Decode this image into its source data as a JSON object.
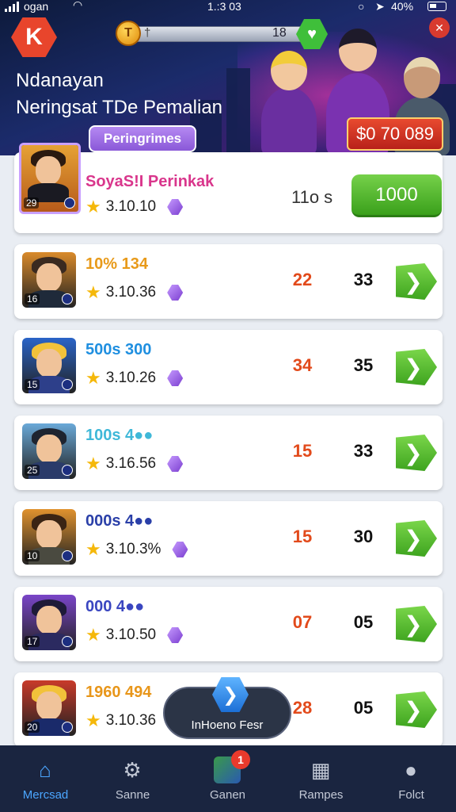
{
  "status_bar": {
    "carrier": "ogan",
    "time": "1.:3 03",
    "battery": "40%"
  },
  "header": {
    "progress_value": "18",
    "progress_coin": "T",
    "progress_pin": "†",
    "title": "Ndanayan",
    "subtitle": "Neringsat TDe Pemalian",
    "prize": "$0 70 089",
    "filter_tab": "Peringrimes"
  },
  "featured": {
    "name": "SoyaS!I Perinkak",
    "name_color": "#d9368c",
    "level": "29",
    "rating": "3.10.10",
    "time": "11o s",
    "claim_label": "1000"
  },
  "rows": [
    {
      "name": "10% 134",
      "name_color": "#e89a1a",
      "level": "16",
      "rating": "3.10.36",
      "col_a": "22",
      "col_b": "33",
      "avatar_bg": "#d98a2a",
      "hair": "#3a2a20",
      "shirt": "#1f2a3a"
    },
    {
      "name": "500s 300",
      "name_color": "#1f8fe0",
      "level": "15",
      "rating": "3.10.26",
      "col_a": "34",
      "col_b": "35",
      "avatar_bg": "#2a64c8",
      "hair": "#f2c23a",
      "shirt": "#2d3f8a"
    },
    {
      "name": "100s 4●●",
      "name_color": "#3fb8d8",
      "level": "25",
      "rating": "3.16.56",
      "col_a": "15",
      "col_b": "33",
      "avatar_bg": "#6aa9d8",
      "hair": "#1e2430",
      "shirt": "#2a3b6a"
    },
    {
      "name": "000s 4●●",
      "name_color": "#2a3fa8",
      "level": "10",
      "rating": "3.10.3%",
      "col_a": "15",
      "col_b": "30",
      "avatar_bg": "#e0922e",
      "hair": "#3a2414",
      "shirt": "#4a4a40"
    },
    {
      "name": "000 4●●",
      "name_color": "#3a46c0",
      "level": "17",
      "rating": "3.10.50",
      "col_a": "07",
      "col_b": "05",
      "avatar_bg": "#7a45c8",
      "hair": "#1e1a38",
      "shirt": "#2b2a60"
    },
    {
      "name": "1960 494",
      "name_color": "#e8961a",
      "level": "20",
      "rating": "3.10.36",
      "col_a": "28",
      "col_b": "05",
      "avatar_bg": "#c83a2a",
      "hair": "#f2c23a",
      "shirt": "#1a2a6a"
    }
  ],
  "toast": {
    "label": "InHoeno Fesr"
  },
  "nav": [
    {
      "label": "Mercsad",
      "icon": "home-icon",
      "active": true
    },
    {
      "label": "Sanne",
      "icon": "gear-icon",
      "active": false
    },
    {
      "label": "Ganen",
      "icon": "game-icon",
      "active": false,
      "badge": "1"
    },
    {
      "label": "Rampes",
      "icon": "grid-icon",
      "active": false
    },
    {
      "label": "Folct",
      "icon": "user-icon",
      "active": false
    }
  ],
  "colors": {
    "accent_green": "#4cb52a",
    "accent_red": "#e8452c",
    "nav_bg": "#1a2540",
    "active_blue": "#4ba6ff"
  }
}
